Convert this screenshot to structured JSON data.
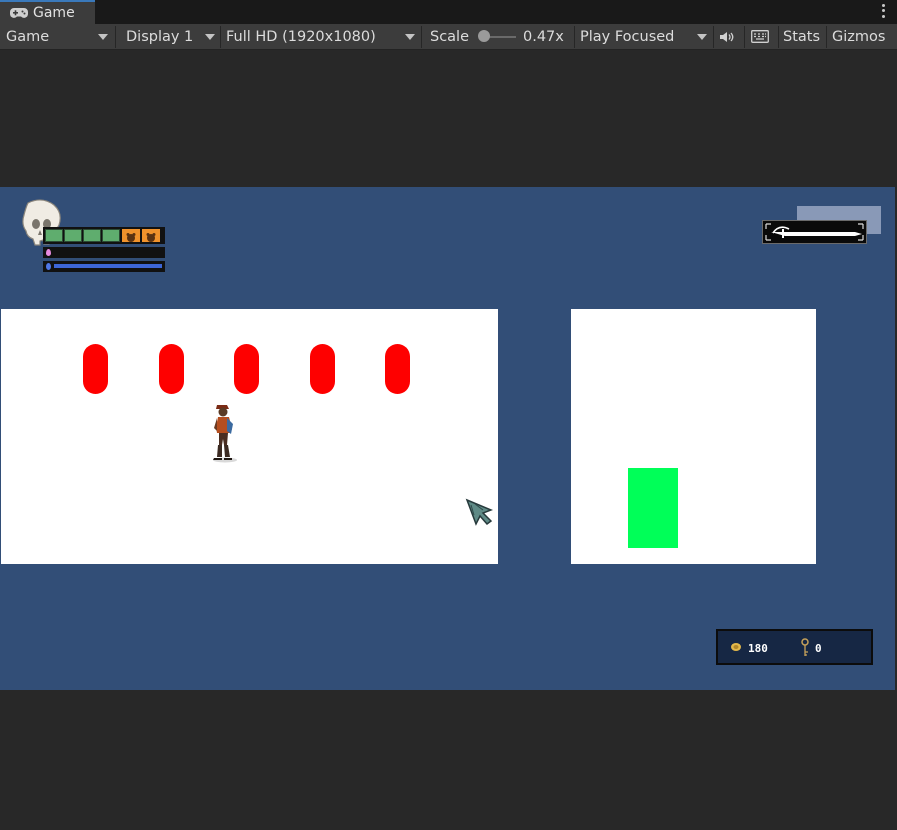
{
  "tab": {
    "title": "Game",
    "icon": "gamepad-icon"
  },
  "toolbar": {
    "view_mode": "Game",
    "display": "Display 1",
    "resolution": "Full HD (1920x1080)",
    "scale_label": "Scale",
    "scale_value": "0.47x",
    "scale_fraction": 0.1,
    "play_mode": "Play Focused",
    "stats_label": "Stats",
    "gizmos_label": "Gizmos"
  },
  "hud": {
    "health_segments": 4,
    "shield_segments": 2,
    "resources": {
      "coins": "180",
      "keys": "0"
    }
  },
  "colors": {
    "game_background": "#324e77",
    "enemy_pill": "#fe0000",
    "goal_block": "#00ff58",
    "health": "#5fad6e",
    "shield": "#f0922c",
    "mana": "#3d66d6"
  }
}
